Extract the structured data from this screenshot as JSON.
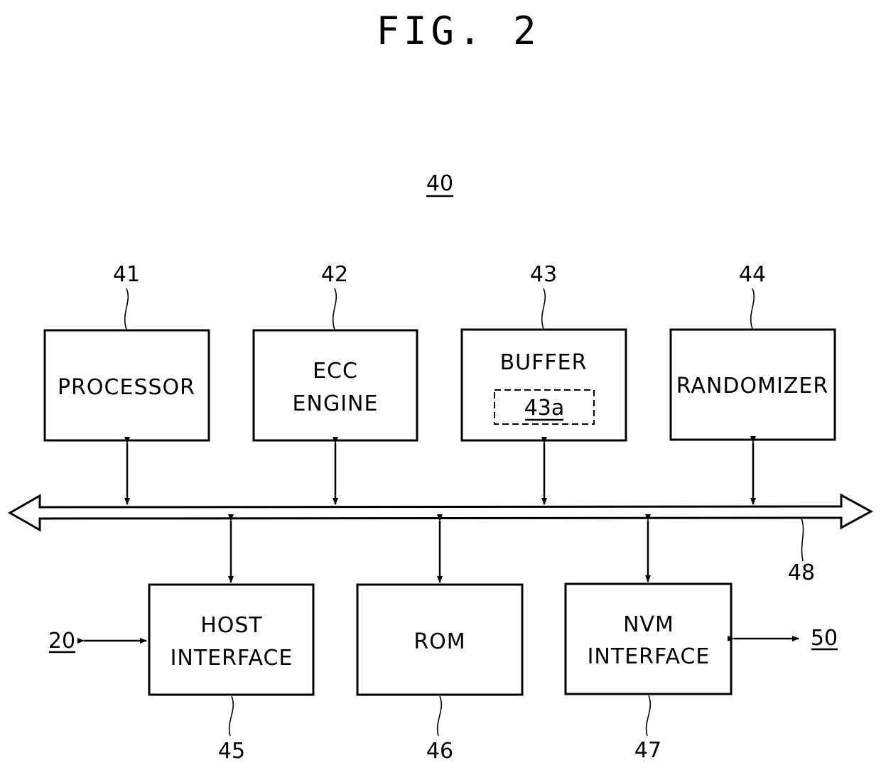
{
  "figure": {
    "title": "FIG. 2",
    "system_ref": "40",
    "bus_ref": "48",
    "external": {
      "host_ref": "20",
      "nvm_ref": "50"
    },
    "top_blocks": [
      {
        "ref": "41",
        "lines": [
          "PROCESSOR"
        ]
      },
      {
        "ref": "42",
        "lines": [
          "ECC",
          "ENGINE"
        ]
      },
      {
        "ref": "43",
        "lines": [
          "BUFFER"
        ],
        "inner_ref": "43a"
      },
      {
        "ref": "44",
        "lines": [
          "RANDOMIZER"
        ]
      }
    ],
    "bottom_blocks": [
      {
        "ref": "45",
        "lines": [
          "HOST",
          "INTERFACE"
        ]
      },
      {
        "ref": "46",
        "lines": [
          "ROM"
        ]
      },
      {
        "ref": "47",
        "lines": [
          "NVM",
          "INTERFACE"
        ]
      }
    ]
  }
}
